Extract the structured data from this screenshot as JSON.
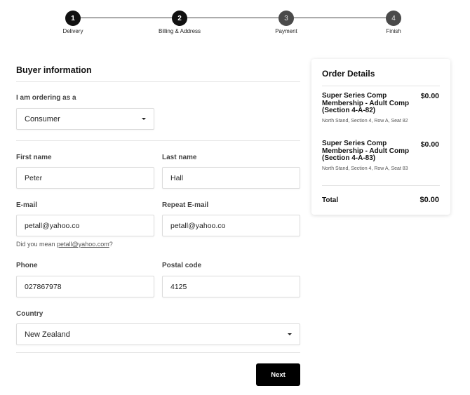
{
  "stepper": {
    "steps": [
      {
        "number": "1",
        "label": "Delivery"
      },
      {
        "number": "2",
        "label": "Billing & Address"
      },
      {
        "number": "3",
        "label": "Payment"
      },
      {
        "number": "4",
        "label": "Finish"
      }
    ],
    "active_step": 2
  },
  "form": {
    "section_title": "Buyer information",
    "ordering_as_label": "I am ordering as a",
    "ordering_as_value": "Consumer",
    "first_name_label": "First name",
    "first_name_value": "Peter",
    "last_name_label": "Last name",
    "last_name_value": "Hall",
    "email_label": "E-mail",
    "email_value": "petall@yahoo.co",
    "repeat_email_label": "Repeat E-mail",
    "repeat_email_value": "petall@yahoo.co",
    "email_hint_prefix": "Did you mean ",
    "email_hint_suggestion": "petall@yahoo.com",
    "email_hint_suffix": "?",
    "phone_label": "Phone",
    "phone_value": "027867978",
    "postal_label": "Postal code",
    "postal_value": "4125",
    "country_label": "Country",
    "country_value": "New Zealand",
    "next_label": "Next"
  },
  "order": {
    "title": "Order Details",
    "items": [
      {
        "name": "Super Series Comp Membership - Adult Comp (Section 4-A-82)",
        "price": "$0.00",
        "desc": "North Stand, Section 4, Row A, Seat 82"
      },
      {
        "name": "Super Series Comp Membership - Adult Comp (Section 4-A-83)",
        "price": "$0.00",
        "desc": "North Stand, Section 4, Row A, Seat 83"
      }
    ],
    "total_label": "Total",
    "total_value": "$0.00"
  },
  "colors": {
    "active_step": "#111111",
    "inactive_step": "#4a4a4a",
    "button": "#000000"
  }
}
